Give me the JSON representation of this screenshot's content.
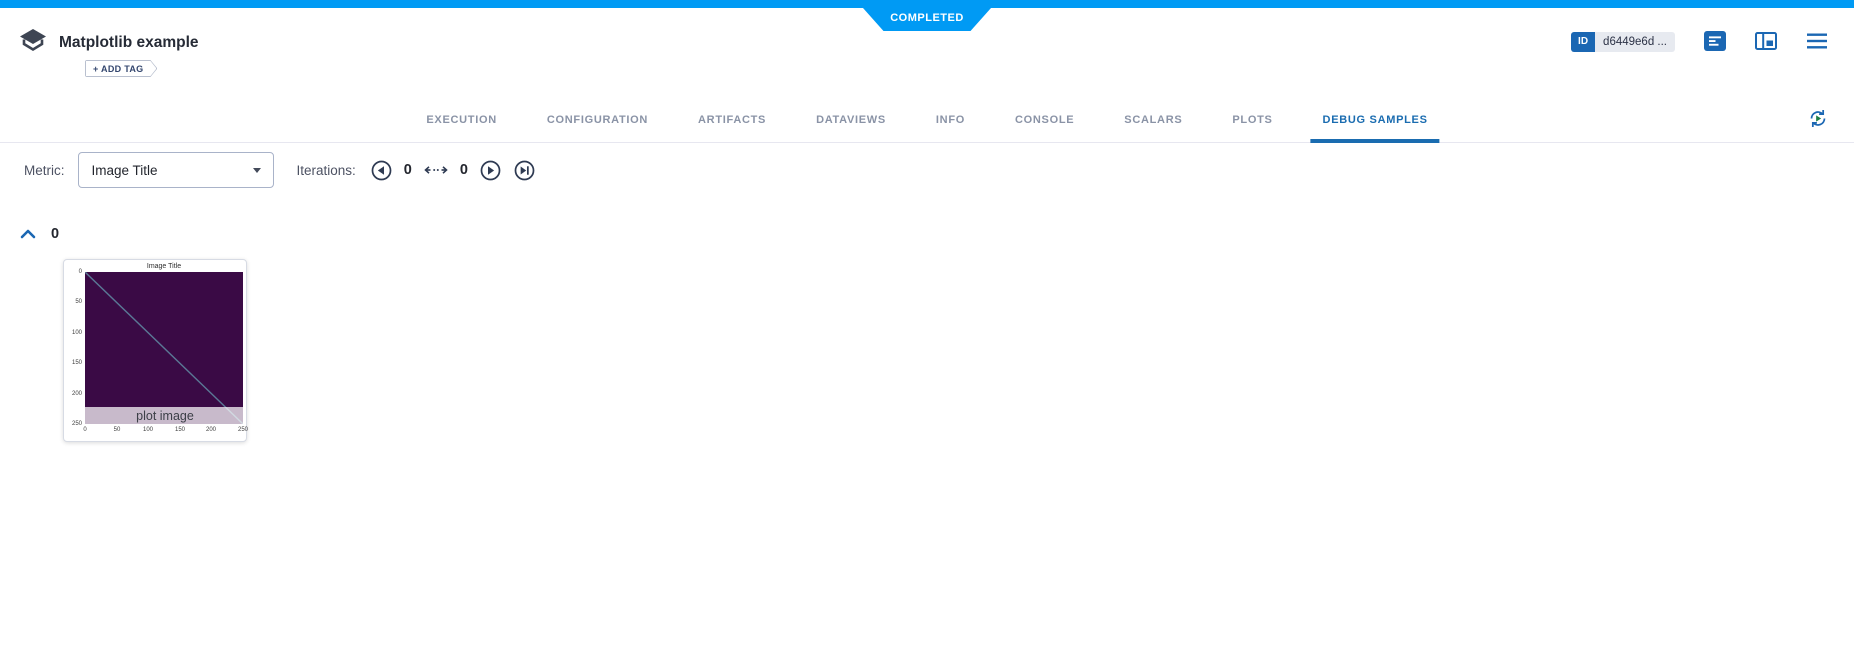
{
  "colors": {
    "top_bar_blue": "#009af4",
    "accent_blue": "#1b67b3",
    "active_tab_blue": "#1a6cb0",
    "inactive_tab_gray": "#8a93a6",
    "plot_background_purple": "#3a0a45",
    "plot_line_slate": "#5a7895"
  },
  "status_banner": {
    "label": "COMPLETED"
  },
  "header": {
    "title": "Matplotlib example",
    "add_tag_label": "+ ADD TAG",
    "id_badge_label": "ID",
    "id_value": "d6449e6d ...",
    "icons": [
      "experiment-icon",
      "details-icon",
      "info-panel-icon",
      "menu-icon"
    ]
  },
  "tabs": {
    "items": [
      {
        "label": "EXECUTION",
        "active": false
      },
      {
        "label": "CONFIGURATION",
        "active": false
      },
      {
        "label": "ARTIFACTS",
        "active": false
      },
      {
        "label": "DATAVIEWS",
        "active": false
      },
      {
        "label": "INFO",
        "active": false
      },
      {
        "label": "CONSOLE",
        "active": false
      },
      {
        "label": "SCALARS",
        "active": false
      },
      {
        "label": "PLOTS",
        "active": false
      },
      {
        "label": "DEBUG SAMPLES",
        "active": true
      }
    ],
    "refresh_icon": "auto-refresh-icon"
  },
  "toolbar": {
    "metric_label": "Metric:",
    "metric_value": "Image Title",
    "iterations_label": "Iterations:",
    "iteration_start": "0",
    "iteration_end": "0"
  },
  "group_header": {
    "label": "0"
  },
  "debug_samples": [
    {
      "caption": "plot image",
      "chart_data": {
        "type": "heatmap",
        "title": "Image Title",
        "x_ticks": [
          "0",
          "50",
          "100",
          "150",
          "200",
          "250"
        ],
        "y_ticks": [
          "0",
          "50",
          "100",
          "150",
          "200",
          "250"
        ],
        "x_range": [
          0,
          250
        ],
        "y_range": [
          0,
          250
        ],
        "background_color": "#3a0a45",
        "annotations": "single diagonal line from (0,0) top-left to (250,250) bottom-right"
      }
    }
  ]
}
